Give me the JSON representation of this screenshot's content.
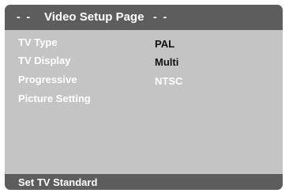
{
  "header": {
    "dashes_left": "- -",
    "title": "Video Setup Page",
    "dashes_right": "- -"
  },
  "menu": {
    "items": [
      {
        "label": "TV Type"
      },
      {
        "label": "TV Display"
      },
      {
        "label": "Progressive"
      },
      {
        "label": "Picture Setting"
      }
    ]
  },
  "options": {
    "items": [
      {
        "label": "PAL",
        "state": "normal"
      },
      {
        "label": "Multi",
        "state": "normal"
      },
      {
        "label": "NTSC",
        "state": "highlighted"
      }
    ]
  },
  "status": {
    "text": "Set TV Standard"
  },
  "colors": {
    "panel": "#c4c4c4",
    "bars": "#5d5d5d",
    "highlight_text": "#ffffff",
    "normal_text": "#111111"
  }
}
